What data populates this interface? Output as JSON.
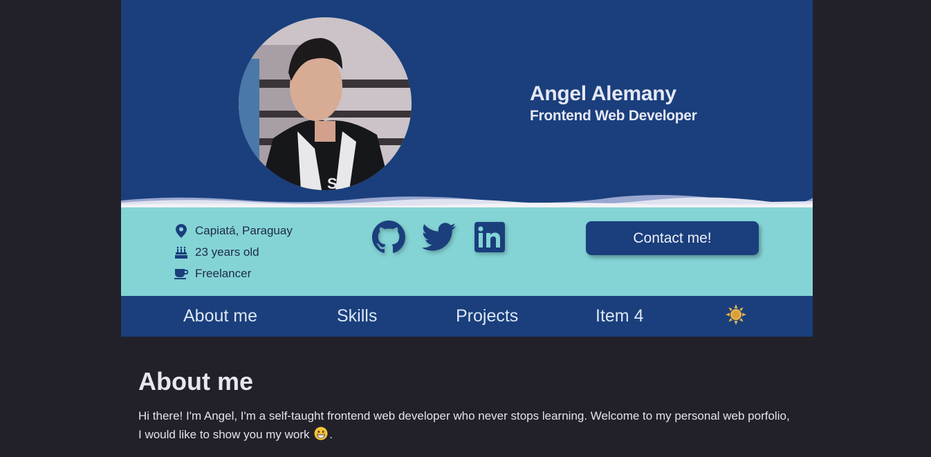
{
  "profile": {
    "name": "Angel Alemany",
    "role": "Frontend Web Developer"
  },
  "facts": [
    {
      "icon": "location-pin-icon",
      "text": "Capiatá, Paraguay"
    },
    {
      "icon": "birthday-cake-icon",
      "text": "23 years old"
    },
    {
      "icon": "coffee-cup-icon",
      "text": "Freelancer"
    }
  ],
  "socials": [
    {
      "icon": "github-icon"
    },
    {
      "icon": "twitter-icon"
    },
    {
      "icon": "linkedin-icon"
    }
  ],
  "contact": {
    "label": "Contact me!"
  },
  "nav": {
    "items": [
      "About me",
      "Skills",
      "Projects",
      "Item 4"
    ],
    "theme_icon": "sun-icon"
  },
  "about": {
    "title": "About me",
    "paragraph": "Hi there! I'm Angel, I'm a self-taught frontend web developer who never stops learning. Welcome to my personal web porfolio, I would like to show you my work",
    "paragraph_end": "."
  },
  "colors": {
    "page_bg": "#22212a",
    "primary": "#1a3f7c",
    "accent": "#84d4d6",
    "sun": "#e6b34a"
  }
}
